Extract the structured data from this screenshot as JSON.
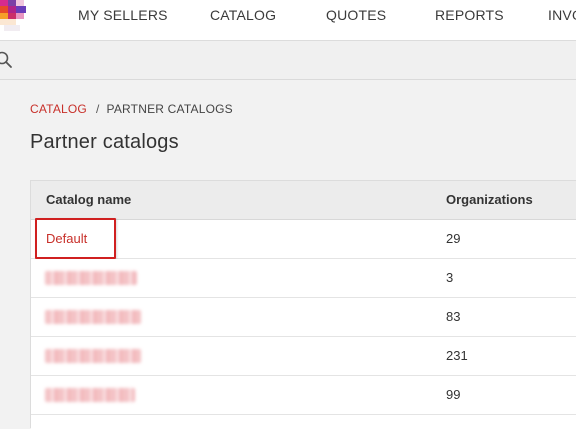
{
  "nav": {
    "items": [
      {
        "label": "MY SELLERS"
      },
      {
        "label": "CATALOG"
      },
      {
        "label": "QUOTES"
      },
      {
        "label": "REPORTS"
      },
      {
        "label": "INVO"
      }
    ]
  },
  "search": {
    "value": "",
    "placeholder": ""
  },
  "breadcrumb": {
    "parent": "CATALOG",
    "separator": "/",
    "current": "PARTNER CATALOGS"
  },
  "page": {
    "title": "Partner catalogs"
  },
  "table": {
    "columns": [
      "Catalog name",
      "Organizations"
    ],
    "rows": [
      {
        "name": "Default",
        "organizations": "29",
        "redacted": false
      },
      {
        "name": "",
        "organizations": "3",
        "redacted": true
      },
      {
        "name": "",
        "organizations": "83",
        "redacted": true
      },
      {
        "name": "",
        "organizations": "231",
        "redacted": true
      },
      {
        "name": "",
        "organizations": "99",
        "redacted": true
      }
    ]
  },
  "colors": {
    "accent": "#c8302a",
    "highlight": "#d02020",
    "header_bg": "#ececec",
    "page_bg": "#f2f2f2"
  },
  "icons": {
    "logo": "brand-logo",
    "search": "search-icon"
  }
}
